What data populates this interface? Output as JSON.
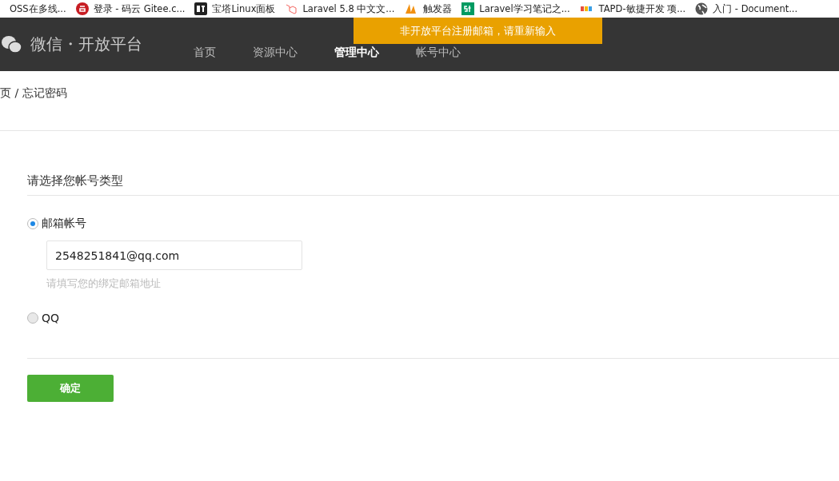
{
  "bookmarks": [
    {
      "kind": "none",
      "label": "OSS在多线..."
    },
    {
      "kind": "gitee",
      "label": "登录 - 码云 Gitee.c..."
    },
    {
      "kind": "bt",
      "label": "宝塔Linux面板"
    },
    {
      "kind": "laravel",
      "label": "Laravel 5.8 中文文..."
    },
    {
      "kind": "pma",
      "label": "触发器"
    },
    {
      "kind": "sf",
      "label": "Laravel学习笔记之..."
    },
    {
      "kind": "tapd",
      "label": "TAPD-敏捷开发 项..."
    },
    {
      "kind": "globe",
      "label": "入门 - Document..."
    }
  ],
  "header": {
    "title": "微信・开放平台",
    "nav": [
      {
        "label": "首页",
        "selected": false
      },
      {
        "label": "资源中心",
        "selected": false
      },
      {
        "label": "管理中心",
        "selected": true
      },
      {
        "label": "帐号中心",
        "selected": false
      }
    ]
  },
  "toast": "非开放平台注册邮箱，请重新输入",
  "breadcrumb": "页 / 忘记密码",
  "form": {
    "heading": "请选择您帐号类型",
    "options": [
      {
        "label": "邮箱帐号",
        "selected": true,
        "field": {
          "value": "2548251841@qq.com",
          "hint": "请填写您的绑定邮箱地址"
        }
      },
      {
        "label": "QQ",
        "selected": false
      }
    ],
    "submit": "确定"
  }
}
